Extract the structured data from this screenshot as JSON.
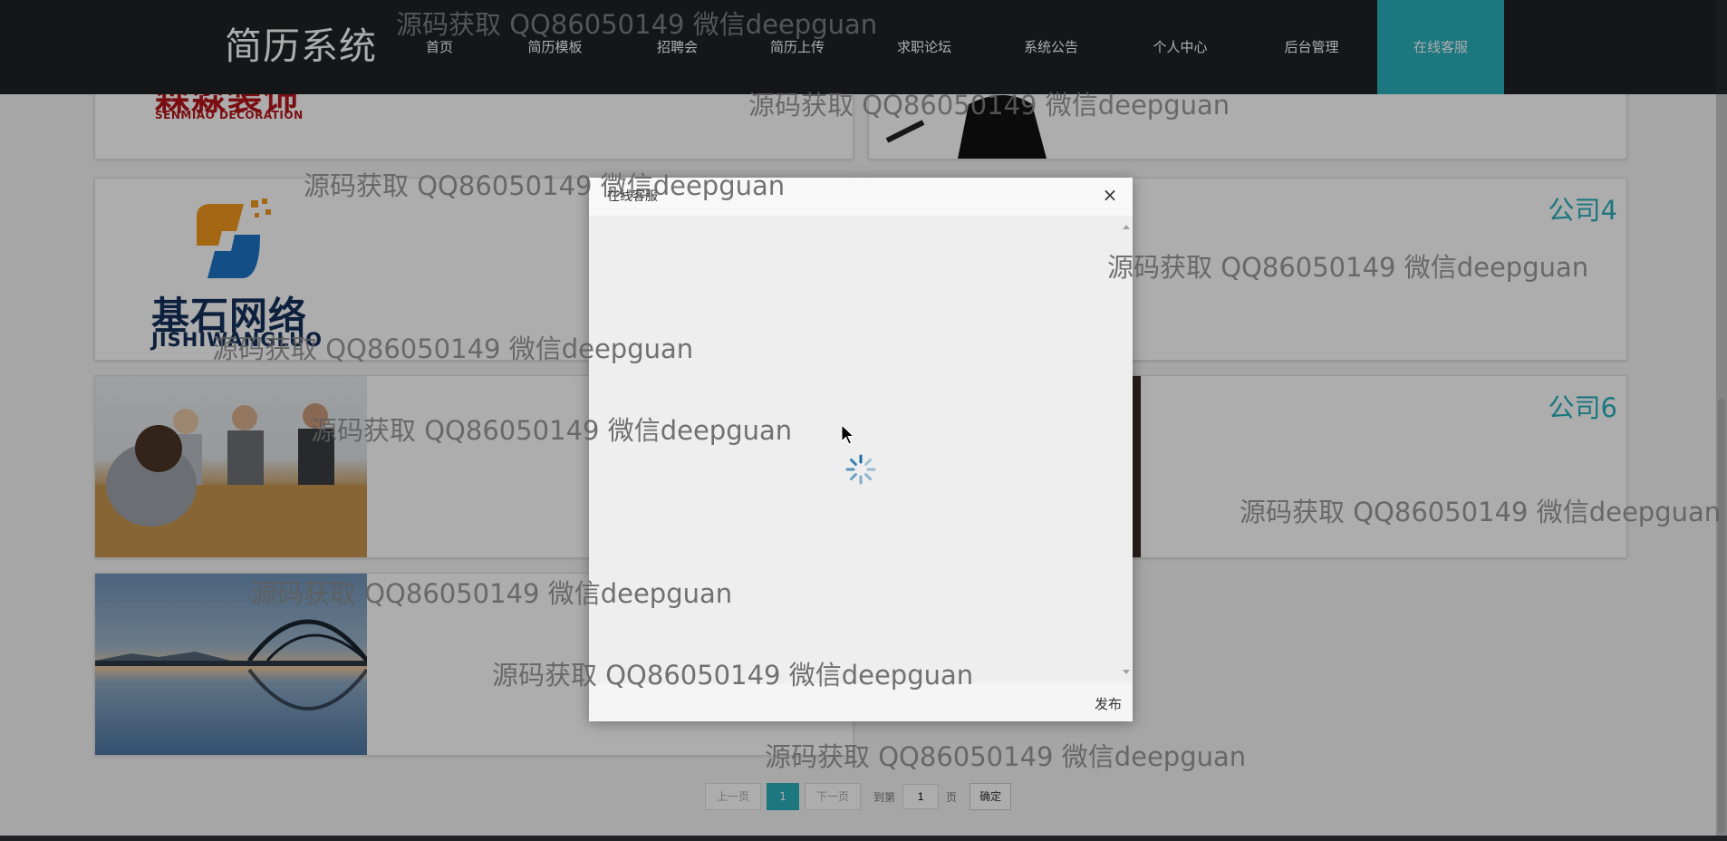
{
  "brand": {
    "title": "简历系统"
  },
  "nav": {
    "items": [
      {
        "label": "首页"
      },
      {
        "label": "简历模板"
      },
      {
        "label": "招聘会"
      },
      {
        "label": "简历上传"
      },
      {
        "label": "求职论坛"
      },
      {
        "label": "系统公告"
      },
      {
        "label": "个人中心"
      },
      {
        "label": "后台管理"
      },
      {
        "label": "在线客服",
        "active": true
      }
    ]
  },
  "companies": {
    "logo1": {
      "cn": "森淼装饰",
      "en": "SENMIAO DECORATION"
    },
    "logo2": {
      "cn": "基石网络",
      "en": "JISHIWANGLUO"
    },
    "card4_title": "公司4",
    "card6_title": "公司6"
  },
  "pagination": {
    "prev": "上一页",
    "current": "1",
    "next": "下一页",
    "goto_label": "到第",
    "page_value": "1",
    "page_unit": "页",
    "confirm": "确定"
  },
  "dialog": {
    "title": "在线客服",
    "close": "×",
    "publish": "发布"
  },
  "watermark": "源码获取 QQ86050149 微信deepguan",
  "colors": {
    "accent": "#2ab0bb",
    "nav_bg": "#1f2124"
  }
}
